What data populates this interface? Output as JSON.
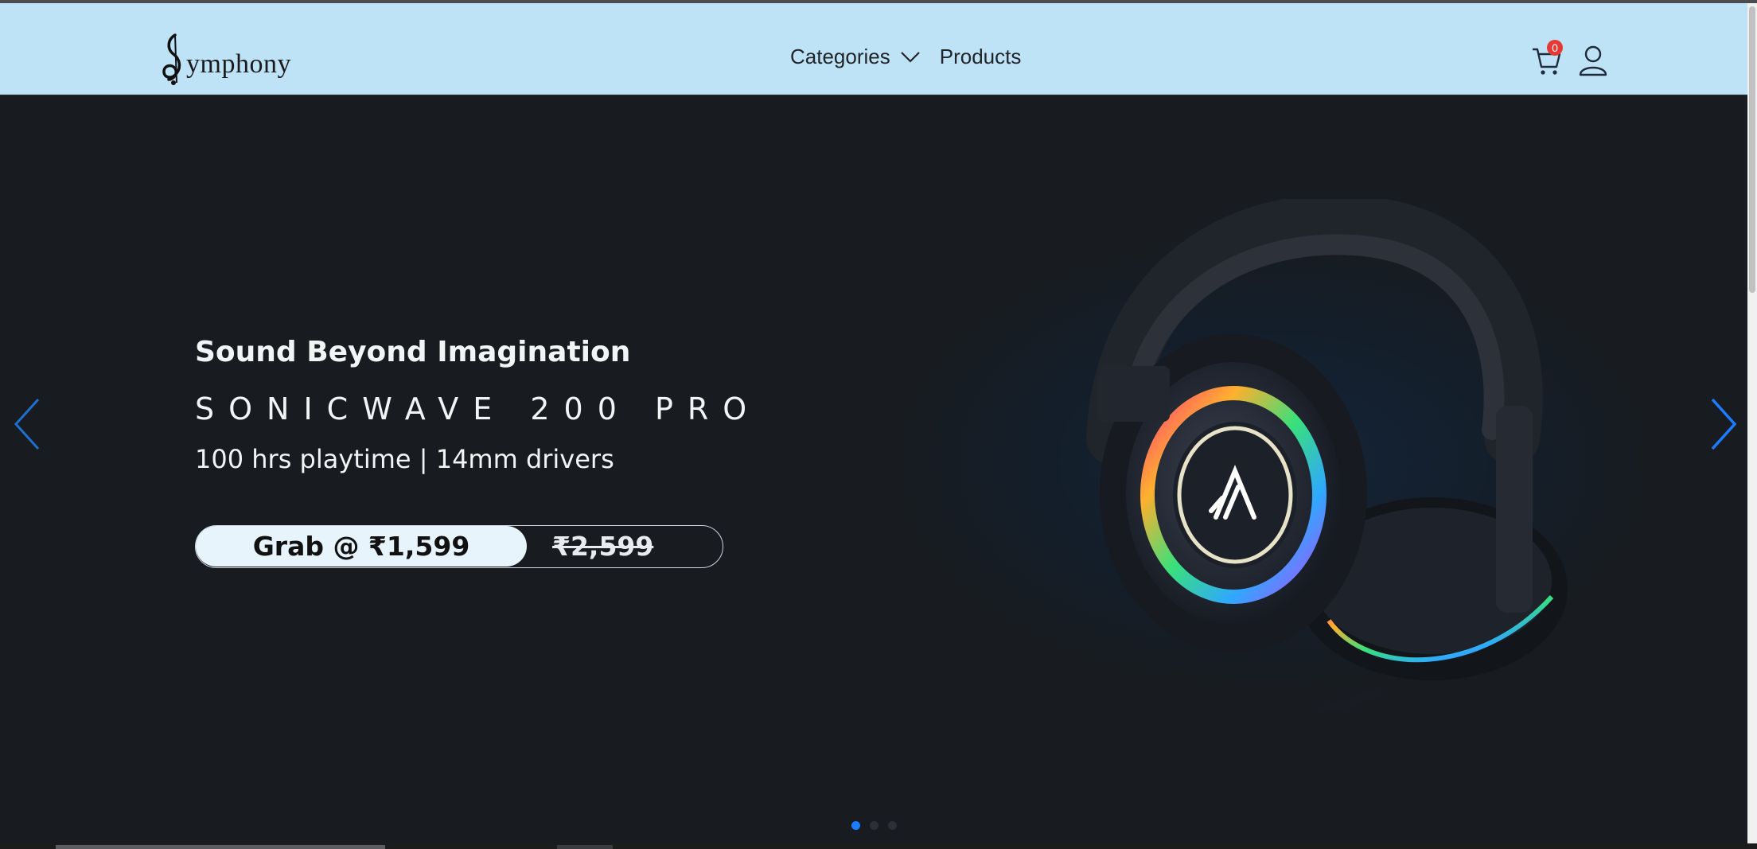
{
  "brand": {
    "name": "ymphony",
    "initial": "S"
  },
  "nav": {
    "categories_label": "Categories",
    "products_label": "Products"
  },
  "cart": {
    "count": "0"
  },
  "hero": {
    "tagline": "Sound Beyond Imagination",
    "product_name": "SONICWAVE 200 PRO",
    "specs": "100 hrs playtime | 14mm drivers",
    "price_label": "Grab @ ₹1,599",
    "original_price": "₹2,599"
  },
  "carousel": {
    "slides": 3,
    "active_index": 0
  },
  "icons": {
    "categories": "chevron-down-icon",
    "cart": "cart-icon",
    "user": "user-icon",
    "prev": "chevron-left-icon",
    "next": "chevron-right-icon"
  },
  "colors": {
    "navbar_bg": "#bee3f7",
    "hero_bg": "#181b1f",
    "accent": "#1a7dff",
    "badge": "#e53935"
  }
}
